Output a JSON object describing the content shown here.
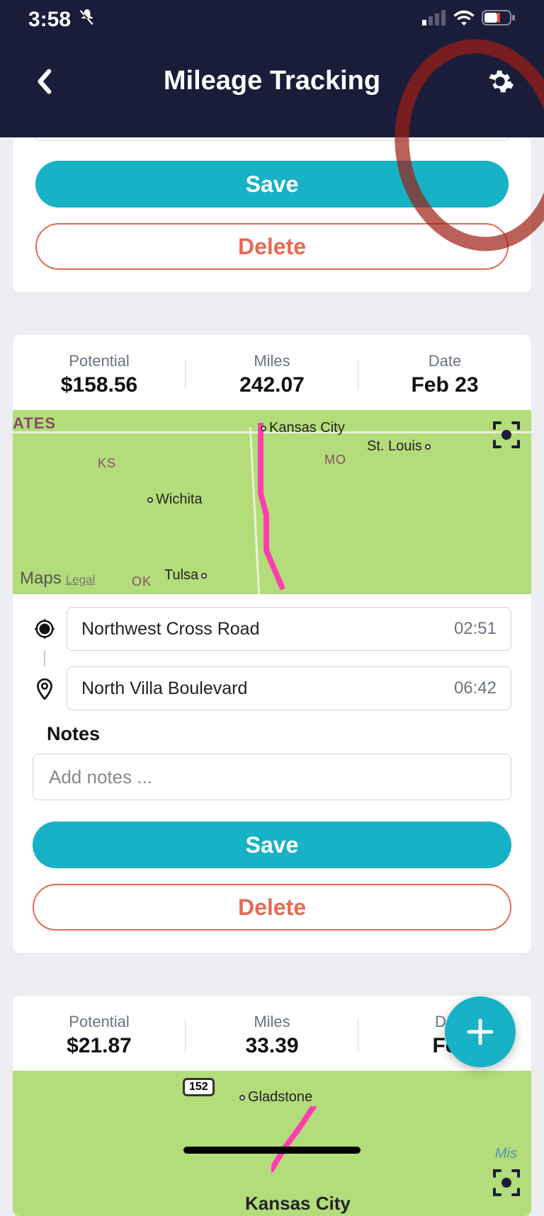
{
  "status": {
    "time": "3:58"
  },
  "header": {
    "title": "Mileage Tracking"
  },
  "buttons": {
    "save": "Save",
    "delete": "Delete"
  },
  "trip_partial": {},
  "trip2": {
    "potential_label": "Potential",
    "potential_value": "$158.56",
    "miles_label": "Miles",
    "miles_value": "242.07",
    "date_label": "Date",
    "date_value": "Feb 23",
    "start_loc": "Northwest Cross Road",
    "start_time": "02:51",
    "end_loc": "North Villa Boulevard",
    "end_time": "06:42",
    "notes_label": "Notes",
    "notes_placeholder": "Add notes ...",
    "map": {
      "cities": [
        "Kansas City",
        "St. Louis",
        "Wichita",
        "Tulsa"
      ],
      "states": [
        "KS",
        "MO",
        "OK"
      ],
      "attribution": "Maps",
      "legal": "Legal",
      "partial_label": "ATES"
    }
  },
  "trip3": {
    "potential_label": "Potential",
    "potential_value": "$21.87",
    "miles_label": "Miles",
    "miles_value": "33.39",
    "date_label": "Da",
    "date_value": "Fe",
    "map": {
      "cities": [
        "Gladstone",
        "Kansas City"
      ],
      "route_badge": "152"
    }
  }
}
